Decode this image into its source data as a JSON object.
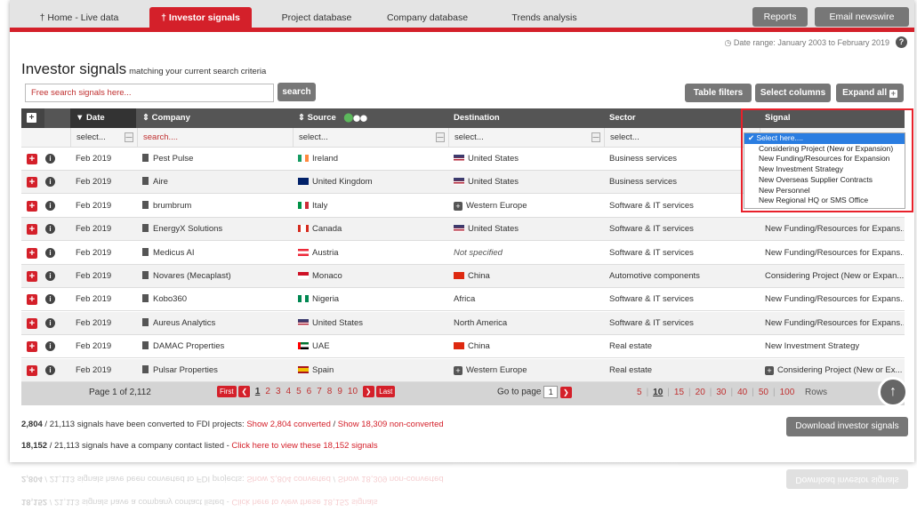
{
  "nav": {
    "tabs": [
      {
        "label": "Home - Live data",
        "icon": "bulb-icon"
      },
      {
        "label": "Investor signals",
        "icon": "bulb-icon",
        "active": true
      },
      {
        "label": "Project database"
      },
      {
        "label": "Company database"
      },
      {
        "label": "Trends analysis"
      }
    ],
    "reports": "Reports",
    "email": "Email newswire"
  },
  "date_range": "Date range: January 2003 to February 2019",
  "help": "?",
  "title": "Investor signals",
  "subtitle": "matching your current search criteria",
  "search": {
    "placeholder": "Free search signals here...",
    "button": "search"
  },
  "buttons": {
    "table_filters": "Table filters",
    "select_columns": "Select columns",
    "expand_all": "Expand all"
  },
  "columns": {
    "date": "Date",
    "company": "Company",
    "source": "Source",
    "destination": "Destination",
    "sector": "Sector",
    "signal": "Signal"
  },
  "filters": {
    "date": "select...",
    "company": "search....",
    "source": "select...",
    "destination": "select...",
    "sector": "select..."
  },
  "rows": [
    {
      "date": "Feb 2019",
      "company": "Pest Pulse",
      "source": "Ireland",
      "dest": "United States",
      "sector": "Business services",
      "signal": ""
    },
    {
      "date": "Feb 2019",
      "company": "Aire",
      "source": "United Kingdom",
      "dest": "United States",
      "sector": "Business services",
      "signal": ""
    },
    {
      "date": "Feb 2019",
      "company": "brumbrum",
      "source": "Italy",
      "dest": "Western Europe",
      "sector": "Software & IT services",
      "signal": ""
    },
    {
      "date": "Feb 2019",
      "company": "EnergyX Solutions",
      "source": "Canada",
      "dest": "United States",
      "sector": "Software & IT services",
      "signal": "New Funding/Resources for Expans..."
    },
    {
      "date": "Feb 2019",
      "company": "Medicus AI",
      "source": "Austria",
      "dest": "Not specified",
      "sector": "Software & IT services",
      "signal": "New Funding/Resources for Expans..."
    },
    {
      "date": "Feb 2019",
      "company": "Novares (Mecaplast)",
      "source": "Monaco",
      "dest": "China",
      "sector": "Automotive components",
      "signal": "Considering Project (New or Expan..."
    },
    {
      "date": "Feb 2019",
      "company": "Kobo360",
      "source": "Nigeria",
      "dest": "Africa",
      "sector": "Software & IT services",
      "signal": "New Funding/Resources for Expans..."
    },
    {
      "date": "Feb 2019",
      "company": "Aureus Analytics",
      "source": "United States",
      "dest": "North America",
      "sector": "Software & IT services",
      "signal": "New Funding/Resources for Expans..."
    },
    {
      "date": "Feb 2019",
      "company": "DAMAC Properties",
      "source": "UAE",
      "dest": "China",
      "sector": "Real estate",
      "signal": "New Investment Strategy"
    },
    {
      "date": "Feb 2019",
      "company": "Pulsar Properties",
      "source": "Spain",
      "dest": "Western Europe",
      "sector": "Real estate",
      "signal": "Considering Project (New or Ex..."
    }
  ],
  "pager": {
    "page_label": "Page 1 of 2,112",
    "first": "First",
    "last": "Last",
    "pages": [
      "1",
      "2",
      "3",
      "4",
      "5",
      "6",
      "7",
      "8",
      "9",
      "10"
    ],
    "goto_label": "Go to page",
    "goto_value": "1",
    "sizes": [
      "5",
      "10",
      "15",
      "20",
      "30",
      "40",
      "50",
      "100"
    ],
    "rows_label": "Rows"
  },
  "footer": {
    "line1_count": "2,804",
    "line1_rest": " / 21,113 signals have been converted to FDI projects: ",
    "line1_link1": "Show 2,804 converted",
    "line1_sep": "  / ",
    "line1_link2": "Show 18,309 non-converted",
    "line2_count": "18,152",
    "line2_rest": " / 21,113 signals have a company contact listed - ",
    "line2_link": "Click here to view these 18,152 signals",
    "download": "Download investor signals"
  },
  "signal_dropdown": [
    "Select here....",
    "Considering Project (New or Expansion)",
    "New Funding/Resources for Expansion",
    "New Investment Strategy",
    "New Overseas Supplier Contracts",
    "New Personnel",
    "New Regional HQ or SMS Office"
  ],
  "colors": {
    "accent": "#d4202a",
    "header": "#555555",
    "button": "#777777",
    "select": "#2a7de1"
  }
}
